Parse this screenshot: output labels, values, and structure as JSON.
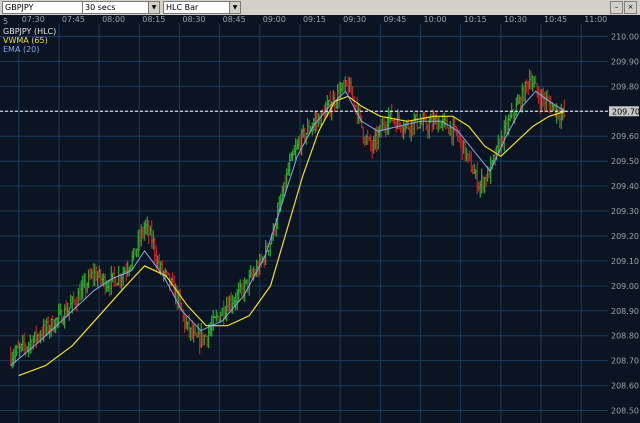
{
  "toolbar": {
    "symbol": "GBPJPY",
    "interval": "30 secs",
    "chart_style": "HLC Bar"
  },
  "colors": {
    "background": "#0a1422",
    "grid": "#1f3a5a",
    "up_bar": "#32c832",
    "down_bar": "#e02828",
    "vwma": "#f0e020",
    "ema": "#8fa6e6",
    "price_line": "#ffffff"
  },
  "legend": {
    "title": "GBPJPY (HLC)",
    "vwma": "VWMA (65)",
    "ema": "EMA (20)"
  },
  "chart_data": {
    "type": "ohlc",
    "title": "GBPJPY (HLC)",
    "x_corner_label": "5",
    "time_ticks": [
      "07:30",
      "07:45",
      "08:00",
      "08:15",
      "08:30",
      "08:45",
      "09:00",
      "09:15",
      "09:30",
      "09:45",
      "10:00",
      "10:15",
      "10:30",
      "10:45",
      "11:00"
    ],
    "y_ticks": [
      "210.00",
      "209.90",
      "209.80",
      "209.70",
      "209.60",
      "209.50",
      "209.40",
      "209.30",
      "209.20",
      "209.10",
      "209.00",
      "208.90",
      "208.80",
      "208.70",
      "208.60",
      "208.50"
    ],
    "ylim": [
      208.45,
      210.05
    ],
    "current_price": "209.70",
    "price_path": [
      [
        "07:27",
        208.72
      ],
      [
        "07:33",
        208.76
      ],
      [
        "07:38",
        208.81
      ],
      [
        "07:43",
        208.85
      ],
      [
        "07:48",
        208.9
      ],
      [
        "07:53",
        208.97
      ],
      [
        "07:58",
        209.05
      ],
      [
        "08:03",
        209.01
      ],
      [
        "08:08",
        209.04
      ],
      [
        "08:13",
        209.12
      ],
      [
        "08:17",
        209.24
      ],
      [
        "08:20",
        209.18
      ],
      [
        "08:22",
        209.08
      ],
      [
        "08:26",
        209.02
      ],
      [
        "08:29",
        208.96
      ],
      [
        "08:32",
        208.85
      ],
      [
        "08:36",
        208.78
      ],
      [
        "08:40",
        208.8
      ],
      [
        "08:44",
        208.87
      ],
      [
        "08:48",
        208.93
      ],
      [
        "08:52",
        208.96
      ],
      [
        "08:56",
        209.02
      ],
      [
        "09:00",
        209.08
      ],
      [
        "09:04",
        209.18
      ],
      [
        "09:08",
        209.34
      ],
      [
        "09:11",
        209.48
      ],
      [
        "09:15",
        209.58
      ],
      [
        "09:19",
        209.64
      ],
      [
        "09:23",
        209.68
      ],
      [
        "09:26",
        209.72
      ],
      [
        "09:30",
        209.78
      ],
      [
        "09:33",
        209.8
      ],
      [
        "09:36",
        209.72
      ],
      [
        "09:39",
        209.6
      ],
      [
        "09:42",
        209.55
      ],
      [
        "09:45",
        209.62
      ],
      [
        "09:48",
        209.68
      ],
      [
        "09:51",
        209.66
      ],
      [
        "09:55",
        209.64
      ],
      [
        "09:58",
        209.66
      ],
      [
        "10:02",
        209.64
      ],
      [
        "10:06",
        209.66
      ],
      [
        "10:10",
        209.64
      ],
      [
        "10:14",
        209.6
      ],
      [
        "10:18",
        209.5
      ],
      [
        "10:22",
        209.4
      ],
      [
        "10:26",
        209.46
      ],
      [
        "10:30",
        209.58
      ],
      [
        "10:34",
        209.68
      ],
      [
        "10:38",
        209.76
      ],
      [
        "10:41",
        209.84
      ],
      [
        "10:44",
        209.76
      ],
      [
        "10:47",
        209.74
      ],
      [
        "10:51",
        209.7
      ],
      [
        "10:54",
        209.68
      ]
    ],
    "series": [
      {
        "name": "VWMA (65)",
        "values": [
          [
            "07:30",
            208.64
          ],
          [
            "07:40",
            208.68
          ],
          [
            "07:50",
            208.76
          ],
          [
            "08:00",
            208.88
          ],
          [
            "08:10",
            209.0
          ],
          [
            "08:17",
            209.08
          ],
          [
            "08:25",
            209.04
          ],
          [
            "08:33",
            208.92
          ],
          [
            "08:40",
            208.84
          ],
          [
            "08:48",
            208.84
          ],
          [
            "08:56",
            208.88
          ],
          [
            "09:04",
            209.0
          ],
          [
            "09:10",
            209.22
          ],
          [
            "09:16",
            209.44
          ],
          [
            "09:22",
            209.62
          ],
          [
            "09:28",
            209.74
          ],
          [
            "09:33",
            209.76
          ],
          [
            "09:38",
            209.72
          ],
          [
            "09:45",
            209.68
          ],
          [
            "09:55",
            209.66
          ],
          [
            "10:05",
            209.68
          ],
          [
            "10:12",
            209.68
          ],
          [
            "10:18",
            209.64
          ],
          [
            "10:24",
            209.56
          ],
          [
            "10:30",
            209.52
          ],
          [
            "10:36",
            209.58
          ],
          [
            "10:42",
            209.64
          ],
          [
            "10:48",
            209.68
          ],
          [
            "10:54",
            209.7
          ]
        ]
      },
      {
        "name": "EMA (20)",
        "values": [
          [
            "07:27",
            208.68
          ],
          [
            "07:38",
            208.78
          ],
          [
            "07:48",
            208.88
          ],
          [
            "07:58",
            208.98
          ],
          [
            "08:05",
            209.03
          ],
          [
            "08:12",
            209.06
          ],
          [
            "08:17",
            209.14
          ],
          [
            "08:24",
            209.04
          ],
          [
            "08:31",
            208.9
          ],
          [
            "08:38",
            208.82
          ],
          [
            "08:46",
            208.86
          ],
          [
            "08:54",
            208.96
          ],
          [
            "09:02",
            209.12
          ],
          [
            "09:08",
            209.32
          ],
          [
            "09:14",
            209.52
          ],
          [
            "09:20",
            209.64
          ],
          [
            "09:26",
            209.72
          ],
          [
            "09:32",
            209.78
          ],
          [
            "09:38",
            209.66
          ],
          [
            "09:44",
            209.62
          ],
          [
            "09:52",
            209.64
          ],
          [
            "10:00",
            209.66
          ],
          [
            "10:08",
            209.66
          ],
          [
            "10:14",
            209.62
          ],
          [
            "10:20",
            209.54
          ],
          [
            "10:26",
            209.46
          ],
          [
            "10:32",
            209.6
          ],
          [
            "10:38",
            209.72
          ],
          [
            "10:43",
            209.78
          ],
          [
            "10:48",
            209.74
          ],
          [
            "10:54",
            209.7
          ]
        ]
      }
    ],
    "grid": true
  }
}
